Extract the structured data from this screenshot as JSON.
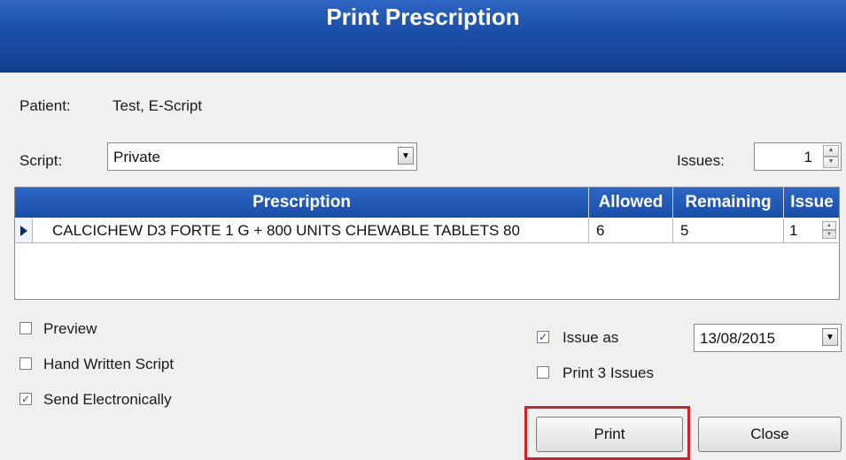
{
  "dialog": {
    "title": "Print Prescription"
  },
  "patient": {
    "label": "Patient:",
    "value": "Test, E-Script"
  },
  "script": {
    "label": "Script:",
    "value": "Private"
  },
  "issues": {
    "label": "Issues:",
    "value": "1"
  },
  "grid": {
    "columns": [
      "Prescription",
      "Allowed",
      "Remaining",
      "Issue"
    ],
    "rows": [
      {
        "prescription": "CALCICHEW D3 FORTE 1 G + 800 UNITS CHEWABLE TABLETS 80",
        "allowed": "6",
        "remaining": "5",
        "issue": "1"
      }
    ]
  },
  "options": {
    "preview": {
      "label": "Preview",
      "checked": false
    },
    "hand_written": {
      "label": "Hand Written Script",
      "checked": false
    },
    "send_electronically": {
      "label": "Send Electronically",
      "checked": true
    },
    "issue_as": {
      "label": "Issue as",
      "checked": true
    },
    "print_3_issues": {
      "label": "Print 3 Issues",
      "checked": false
    }
  },
  "issue_date": {
    "value": "13/08/2015"
  },
  "buttons": {
    "print": "Print",
    "close": "Close"
  },
  "colors": {
    "accent": "#1b4ea6",
    "highlight": "#d4202a"
  }
}
